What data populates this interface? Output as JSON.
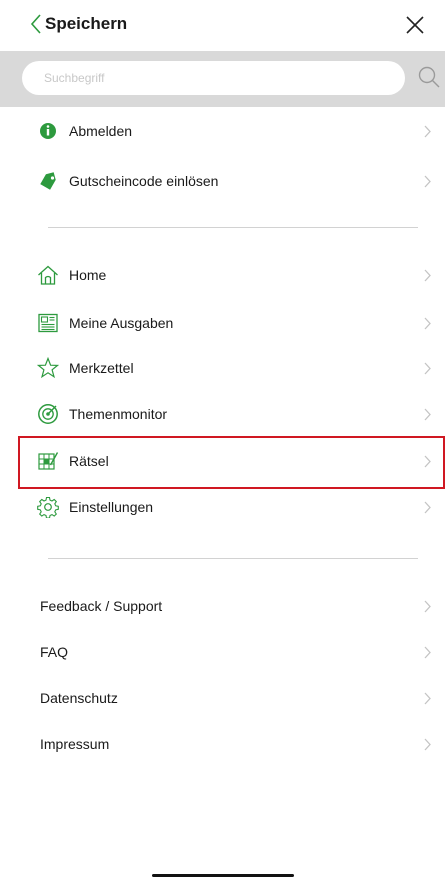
{
  "header": {
    "back_label": "Speichern",
    "back_icon": "chevron-left-icon",
    "close_icon": "close-icon"
  },
  "search": {
    "placeholder": "Suchbegriff",
    "value": "",
    "icon": "search-icon"
  },
  "account_items": [
    {
      "label": "Abmelden",
      "icon": "info-circle-icon"
    },
    {
      "label": "Gutscheincode einlösen",
      "icon": "tag-icon"
    }
  ],
  "nav_items": [
    {
      "label": "Home",
      "icon": "home-icon"
    },
    {
      "label": "Meine Ausgaben",
      "icon": "newspaper-icon"
    },
    {
      "label": "Merkzettel",
      "icon": "star-icon"
    },
    {
      "label": "Themenmonitor",
      "icon": "radar-icon"
    },
    {
      "label": "Rätsel",
      "icon": "crossword-icon",
      "highlighted": true
    },
    {
      "label": "Einstellungen",
      "icon": "gear-icon"
    }
  ],
  "info_items": [
    {
      "label": "Feedback / Support"
    },
    {
      "label": "FAQ"
    },
    {
      "label": "Datenschutz"
    },
    {
      "label": "Impressum"
    }
  ],
  "colors": {
    "accent_green": "#2d9a3e",
    "highlight_red": "#d01822",
    "search_bar_bg": "#d9d9d9",
    "chevron_gray": "#c4c4c4"
  }
}
